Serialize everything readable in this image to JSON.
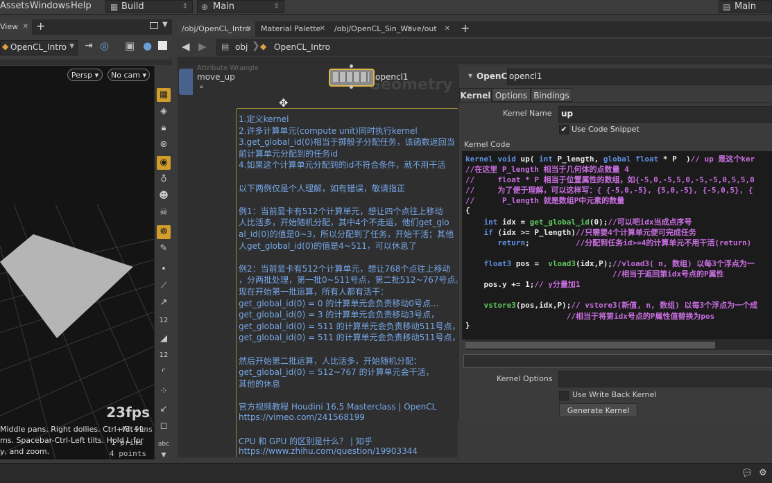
{
  "menubar": {
    "items": [
      "Assets",
      "Windows",
      "Help"
    ],
    "desktop_label": "Build",
    "network_label": "Main",
    "right_label": "Main"
  },
  "left_pane": {
    "tab_label": "View",
    "node_selector": "OpenCL_Intro",
    "persp_label": "Persp",
    "cam_label": "No cam",
    "fps": "23fps",
    "frame_time": "43.99ms",
    "prims": "1 prims",
    "points": "4 points",
    "help_lines": [
      "Middle pans. Right dollies. Ctrl+Alt+L",
      "ms. Spacebar-Ctrl-Left tilts. Hold L for",
      "y, and zoom."
    ]
  },
  "tabs": [
    "/obj/OpenCL_Intro",
    "Material Palette",
    "/obj/OpenCL_Sin_Wave",
    "/out"
  ],
  "path": {
    "root": "obj",
    "node": "OpenCL_Intro"
  },
  "network": {
    "wrangle_type": "Attribute Wrangle",
    "wrangle_name": "move_up",
    "opencl_name": "opencl1",
    "watermark": "Geometry",
    "note_lines": [
      "1.定义kernel",
      "2.许多计算单元(compute unit)同时执行kernel",
      "3.get_global_id(0)相当于掷骰子分配任务，该函数返回当",
      "前计算单元分配到的任务id",
      "4.如果这个计算单元分配到的id不符合条件，就不用干活",
      "",
      "以下两例仅是个人理解，如有错误，敬请指正",
      "",
      "例1：当前显卡有512个计算单元，想让四个点往上移动",
      "人比活多，开始随机分配，其中4个不走运，他们get_glo",
      "al_id(0)的值是0~3，所以分配到了任务，开始干活；其他",
      "人get_global_id(0)的值是4~511，可以休息了",
      "",
      "例2：当前显卡有512个计算单元，想让768个点往上移动",
      "，分两批处理，第一批0~511号点，第二批512~767号点。",
      "现在开始第一批运算，所有人都有活干：",
      "get_global_id(0) = 0 的计算单元会负责移动0号点...",
      "get_global_id(0) = 3 的计算单元会负责移动3号点，",
      "get_global_id(0) = 511 的计算单元会负责移动511号点，",
      "get_global_id(0) = 511 的计算单元会负责移动511号点，",
      "",
      "然后开始第二批运算，人比活多，开始随机分配：",
      "get_global_id(0) = 512~767 的计算单元会干活，",
      "其他的休息",
      "",
      "官方视频教程 Houdini 16.5 Masterclass | OpenCL",
      "https://vimeo.com/241568199",
      "",
      "CPU 和 GPU 的区别是什么？ | 知乎",
      "https://www.zhihu.com/question/19903344"
    ]
  },
  "params": {
    "node_type": "OpenCL",
    "node_name": "opencl1",
    "tabs": [
      "Kernel",
      "Options",
      "Bindings"
    ],
    "kernel_name_label": "Kernel Name",
    "kernel_name_value": "up",
    "use_snippet_label": "Use Code Snippet",
    "kernel_code_label": "Kernel Code",
    "kernel_options_label": "Kernel Options",
    "write_back_label": "Use Write Back Kernel",
    "generate_label": "Generate Kernel",
    "code_lines": [
      "kernel void up( int P_length, global float * P  )// up 是这个ker",
      "//在这里 P_length 相当于几何体的点数量 4",
      "//     float * P 相当于位置属性的数组，如{-5,0,-5,5,0,-5,-5,0,5,5,0",
      "//     为了便于理解，可以这样写：{ {-5,0,-5}, {5,0,-5}, {-5,0,5}, {",
      "//      P_length 就是数组P中元素的数量",
      "{",
      "    int idx = get_global_id(0);//可以吧idx当成点序号",
      "    if (idx >= P_length)//只需要4个计算单元便可完成任务",
      "       return;          //分配到任务id>=4的计算单元不用干活(return)",
      "",
      "    float3 pos =  vload3(idx,P);//vload3( n, 数组) 以每3个浮点为一",
      "                                //相当于返回第idx号点的P属性",
      "    pos.y += 1;// y分量加1",
      "",
      "    vstore3(pos,idx,P);// vstore3(新值, n, 数组) 以每3个浮点为一个成",
      "                      //相当于将第idx号点的P属性值替换为pos",
      "}"
    ]
  }
}
